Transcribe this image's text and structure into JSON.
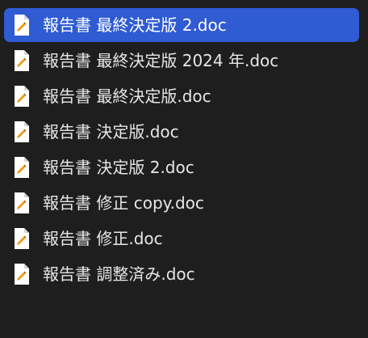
{
  "file_list": {
    "selected_index": 0,
    "files": [
      {
        "name": "報告書 最終決定版 2.doc",
        "icon": "pencil-document-icon"
      },
      {
        "name": "報告書 最終決定版 2024 年.doc",
        "icon": "pencil-document-icon"
      },
      {
        "name": "報告書 最終決定版.doc",
        "icon": "pencil-document-icon"
      },
      {
        "name": "報告書 決定版.doc",
        "icon": "pencil-document-icon"
      },
      {
        "name": "報告書 決定版 2.doc",
        "icon": "pencil-document-icon"
      },
      {
        "name": "報告書 修正 copy.doc",
        "icon": "pencil-document-icon"
      },
      {
        "name": "報告書 修正.doc",
        "icon": "pencil-document-icon"
      },
      {
        "name": "報告書 調整済み.doc",
        "icon": "pencil-document-icon"
      }
    ]
  },
  "colors": {
    "background": "#1e1e1e",
    "selection": "#2f5bd3",
    "text": "#e7e7e7",
    "icon_accent": "#f39a1a"
  }
}
